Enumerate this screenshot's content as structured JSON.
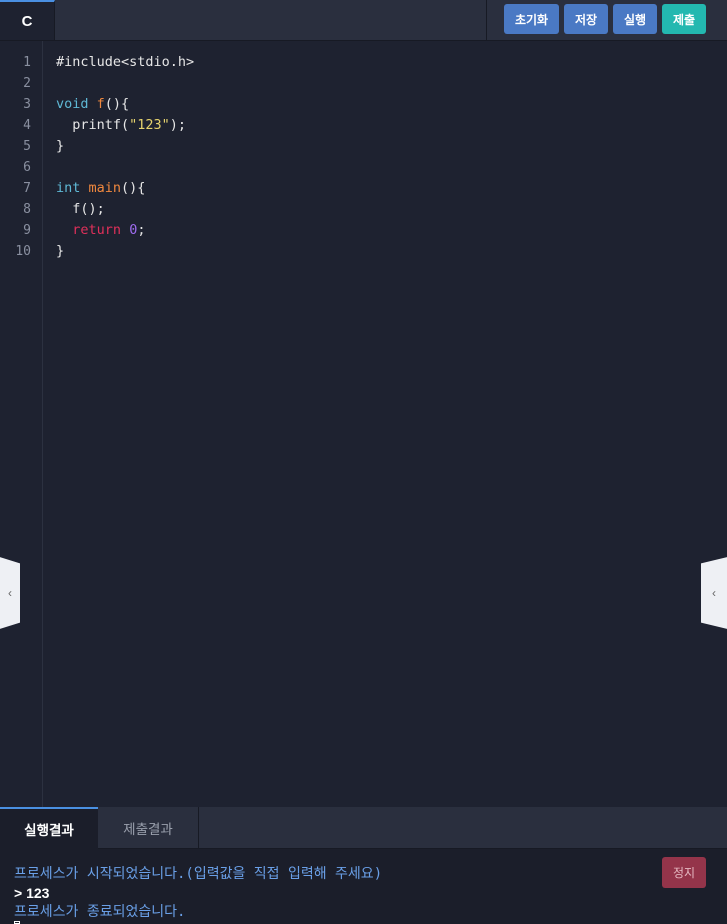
{
  "editor": {
    "language": "C",
    "line_numbers": [
      "1",
      "2",
      "3",
      "4",
      "5",
      "6",
      "7",
      "8",
      "9",
      "10"
    ],
    "code": {
      "l1": "#include<stdio.h>",
      "l3_kw": "void",
      "l3_fn": "f",
      "l3_rest": "(){",
      "l4_pre": "  printf(",
      "l4_str": "\"123\"",
      "l4_post": ");",
      "l5": "}",
      "l7_kw": "int",
      "l7_fn": "main",
      "l7_rest": "(){",
      "l8": "  f();",
      "l9_kw": "return",
      "l9_num": "0",
      "l9_post": ";",
      "l10": "}"
    }
  },
  "toolbar": {
    "reset_label": "초기화",
    "save_label": "저장",
    "run_label": "실행",
    "submit_label": "제출"
  },
  "console": {
    "tab_run": "실행결과",
    "tab_submit": "제출결과",
    "stop_label": "정지",
    "lines": {
      "started": "프로세스가 시작되었습니다.(입력값을 직접 입력해 주세요)",
      "result": "> 123",
      "ended": "프로세스가 종료되었습니다."
    }
  },
  "colors": {
    "accent": "#4a90e2",
    "submit": "#23b8b0",
    "stop": "#94344a",
    "keyword": "#5fb9d6",
    "function": "#f0883e",
    "string": "#e6d36e",
    "return": "#e0305a",
    "number": "#9f6cf0"
  }
}
